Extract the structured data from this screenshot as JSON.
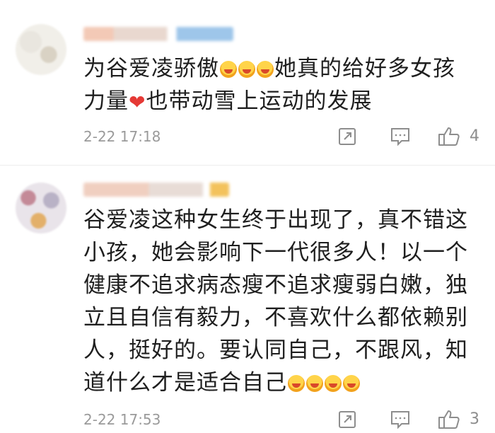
{
  "comments": [
    {
      "text_1": "为谷爱凌骄傲",
      "text_2": "她真的给好多女孩",
      "text_3": "力量",
      "text_4": "也带动雪上运动的发展",
      "heart": "❤",
      "time": "2-22 17:18",
      "likes": "4",
      "icons": [
        "share-icon",
        "comment-icon",
        "thumbs-up-icon"
      ]
    },
    {
      "line_1": "谷爱凌这种女生终于出现了，真不错这",
      "line_2": "小孩，她会影响下一代很多人！以一个",
      "line_3": "健康不追求病态瘦不追求瘦弱白嫩，独",
      "line_4": "立且自信有毅力，不喜欢什么都依赖别",
      "line_5": "人，挺好的。要认同自己，不跟风，知",
      "line_6": "道什么才是适合自己",
      "time": "2-22 17:53",
      "likes": "3",
      "icons": [
        "share-icon",
        "comment-icon",
        "thumbs-up-icon"
      ]
    }
  ]
}
